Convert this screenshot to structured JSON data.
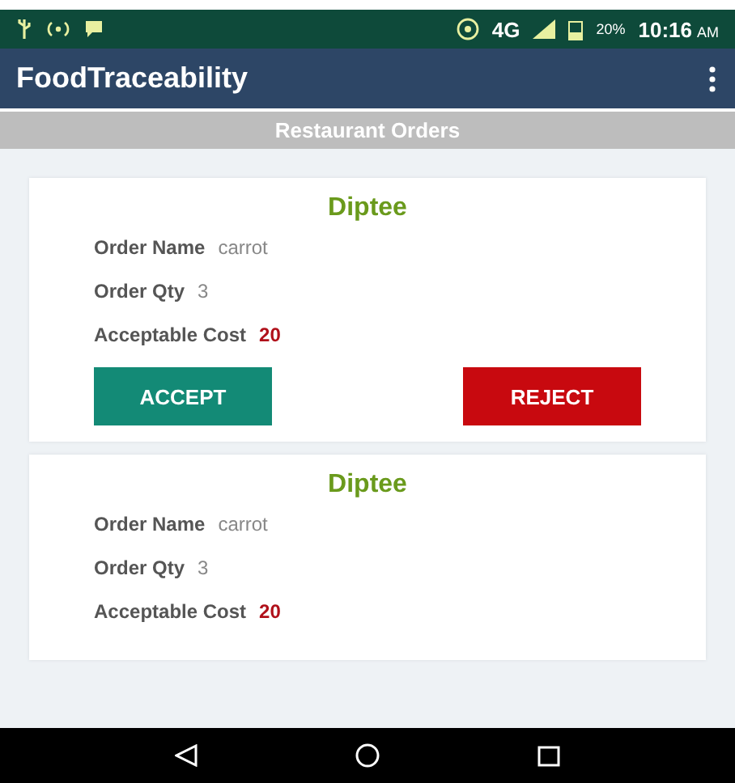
{
  "status_bar": {
    "network": "4G",
    "battery": "20%",
    "time": "10:16",
    "time_suffix": "AM"
  },
  "app_bar": {
    "title": "FoodTraceability"
  },
  "section_header": "Restaurant Orders",
  "orders": [
    {
      "customer": "Diptee",
      "fields": [
        {
          "label": "Order Name",
          "value": "carrot",
          "kind": "plain"
        },
        {
          "label": "Order Qty",
          "value": "3",
          "kind": "plain"
        },
        {
          "label": "Acceptable Cost",
          "value": "20",
          "kind": "price"
        }
      ],
      "buttons": [
        {
          "label": "ACCEPT",
          "kind": "accept"
        },
        {
          "label": "REJECT",
          "kind": "reject"
        }
      ]
    },
    {
      "customer": "Diptee",
      "fields": [
        {
          "label": "Order Name",
          "value": "carrot",
          "kind": "plain"
        },
        {
          "label": "Order Qty",
          "value": "3",
          "kind": "plain"
        },
        {
          "label": "Acceptable Cost",
          "value": "20",
          "kind": "price"
        }
      ]
    }
  ]
}
